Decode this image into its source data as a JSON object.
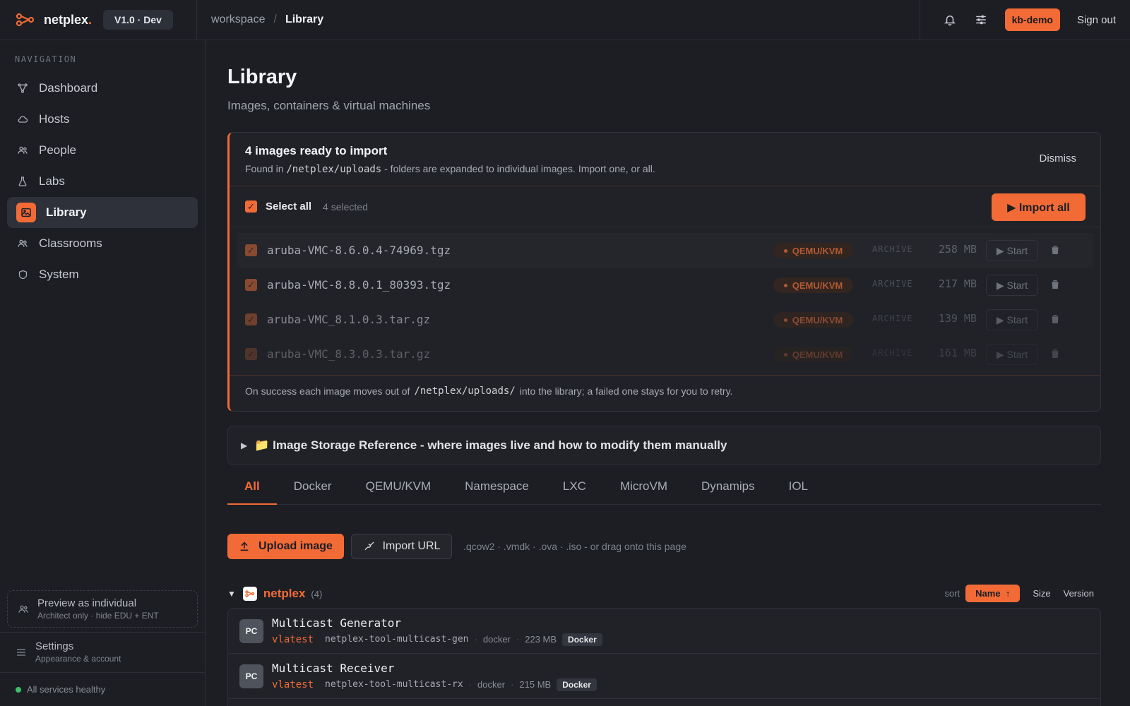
{
  "brand": {
    "name": "netplex",
    "dot": ".",
    "version": "V1.0 · Dev"
  },
  "breadcrumb": {
    "parent": "workspace",
    "separator": "/",
    "current": "Library"
  },
  "topbar": {
    "user": "kb-demo",
    "signout": "Sign out",
    "icons": [
      "bell-icon",
      "sliders-icon"
    ]
  },
  "sidebar": {
    "heading": "NAVIGATION",
    "items": [
      {
        "label": "Dashboard",
        "icon": "graph-icon"
      },
      {
        "label": "Hosts",
        "icon": "cloud-icon"
      },
      {
        "label": "People",
        "icon": "people-icon"
      },
      {
        "label": "Labs",
        "icon": "flask-icon"
      },
      {
        "label": "Library",
        "icon": "image-icon",
        "active": true
      },
      {
        "label": "Classrooms",
        "icon": "people-icon"
      },
      {
        "label": "System",
        "icon": "shield-icon"
      }
    ],
    "preview": {
      "title": "Preview as individual",
      "subtitle": "Architect only · hide EDU + ENT"
    },
    "settings": {
      "title": "Settings",
      "subtitle": "Appearance & account"
    },
    "health": "All services healthy"
  },
  "page": {
    "title": "Library",
    "subtitle": "Images, containers & virtual machines"
  },
  "import_panel": {
    "title": "4 images ready to import",
    "desc_prefix": "Found in",
    "desc_path": "/netplex/uploads",
    "desc_suffix": "- folders are expanded to individual images. Import one, or all.",
    "dismiss": "Dismiss",
    "select_all": "Select all",
    "selected_count": "4 selected",
    "import_all": "▶ Import all",
    "rows": [
      {
        "file": "aruba-VMC-8.6.0.4-74969.tgz",
        "type": "QEMU/KVM",
        "kind": "ARCHIVE",
        "size": "258 MB",
        "start": "▶ Start"
      },
      {
        "file": "aruba-VMC-8.8.0.1_80393.tgz",
        "type": "QEMU/KVM",
        "kind": "ARCHIVE",
        "size": "217 MB",
        "start": "▶ Start"
      },
      {
        "file": "aruba-VMC_8.1.0.3.tar.gz",
        "type": "QEMU/KVM",
        "kind": "ARCHIVE",
        "size": "139 MB",
        "start": "▶ Start"
      },
      {
        "file": "aruba-VMC_8.3.0.3.tar.gz",
        "type": "QEMU/KVM",
        "kind": "ARCHIVE",
        "size": "161 MB",
        "start": "▶ Start"
      }
    ],
    "foot_prefix": "On success each image moves out of",
    "foot_path": "/netplex/uploads/",
    "foot_suffix": "into the library; a failed one stays for you to retry."
  },
  "storage_ref": "📁 Image Storage Reference - where images live and how to modify them manually",
  "tabs": [
    "All",
    "Docker",
    "QEMU/KVM",
    "Namespace",
    "LXC",
    "MicroVM",
    "Dynamips",
    "IOL"
  ],
  "actions": {
    "upload": "Upload image",
    "import_url": "Import URL",
    "hint": ".qcow2 · .vmdk · .ova · .iso - or drag onto this page"
  },
  "group": {
    "name": "netplex",
    "count": "(4)",
    "sort_label": "sort",
    "sort_active": "Name",
    "sort_options": [
      "Size",
      "Version"
    ]
  },
  "images": [
    {
      "initials": "PC",
      "name": "Multicast Generator",
      "version": "vlatest",
      "ref": "netplex-tool-multicast-gen",
      "runtime": "docker",
      "size": "223 MB",
      "badge": "Docker"
    },
    {
      "initials": "PC",
      "name": "Multicast Receiver",
      "version": "vlatest",
      "ref": "netplex-tool-multicast-rx",
      "runtime": "docker",
      "size": "215 MB",
      "badge": "Docker"
    }
  ],
  "colors": {
    "accent": "#f26b36",
    "background": "#1c1e24",
    "panel": "#202228",
    "healthy": "#3fbf6a"
  }
}
